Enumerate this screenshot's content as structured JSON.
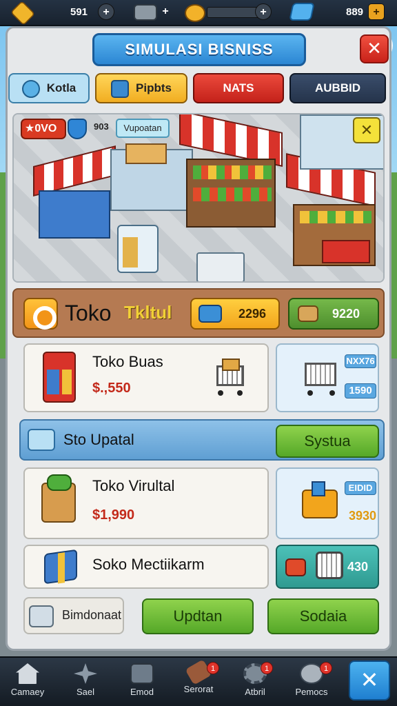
{
  "resources": [
    {
      "value": "591",
      "icon": "gold-chest-icon",
      "action": "+"
    },
    {
      "value": "",
      "icon": "machine-icon",
      "action": "+"
    },
    {
      "value": "",
      "icon": "gear-bar-icon",
      "action": "+"
    },
    {
      "value": "889",
      "icon": "gem-icon",
      "action": "+"
    }
  ],
  "title": "SIMULASI BISNISS",
  "tabs": [
    {
      "label": "Kotla",
      "icon": "globe-icon",
      "color": "#7fc4ea"
    },
    {
      "label": "Pipbts",
      "icon": "box-icon",
      "color": "#f5c23d"
    },
    {
      "label": "NATS",
      "icon": "",
      "color": "#d9302a"
    },
    {
      "label": "AUBBID",
      "icon": "",
      "color": "#2e3f59"
    }
  ],
  "scene": {
    "rating": "0VO",
    "count": "903",
    "label": "Vupoatan"
  },
  "header": {
    "title": "Toko",
    "subtitle": "Tkltul",
    "stat1": "2296",
    "stat2": "9220"
  },
  "items": [
    {
      "name": "Toko Buas",
      "price": "$.,550",
      "side_tag": "NXX76",
      "side_value": "1590"
    },
    {
      "name": "Toko Virultal",
      "price": "$1,990",
      "side_tag": "EIDID",
      "side_value": "3930"
    },
    {
      "name": "Soko Mectiikarm",
      "price": "",
      "side_tag": "",
      "side_value": "430"
    }
  ],
  "upgrade_row": {
    "label": "Sto Upatal",
    "button": "Systua"
  },
  "footer": {
    "label": "Bimdonaat",
    "button1": "Updtan",
    "button2": "Sodaia"
  },
  "nav": [
    {
      "label": "Camaey",
      "icon": "home-icon",
      "badge": ""
    },
    {
      "label": "Sael",
      "icon": "star-icon",
      "badge": ""
    },
    {
      "label": "Emod",
      "icon": "crate-icon",
      "badge": ""
    },
    {
      "label": "Serorat",
      "icon": "hammer-icon",
      "badge": "1"
    },
    {
      "label": "Atbril",
      "icon": "gear-icon",
      "badge": "1"
    },
    {
      "label": "Pemocs",
      "icon": "coin-icon",
      "badge": "1"
    }
  ]
}
